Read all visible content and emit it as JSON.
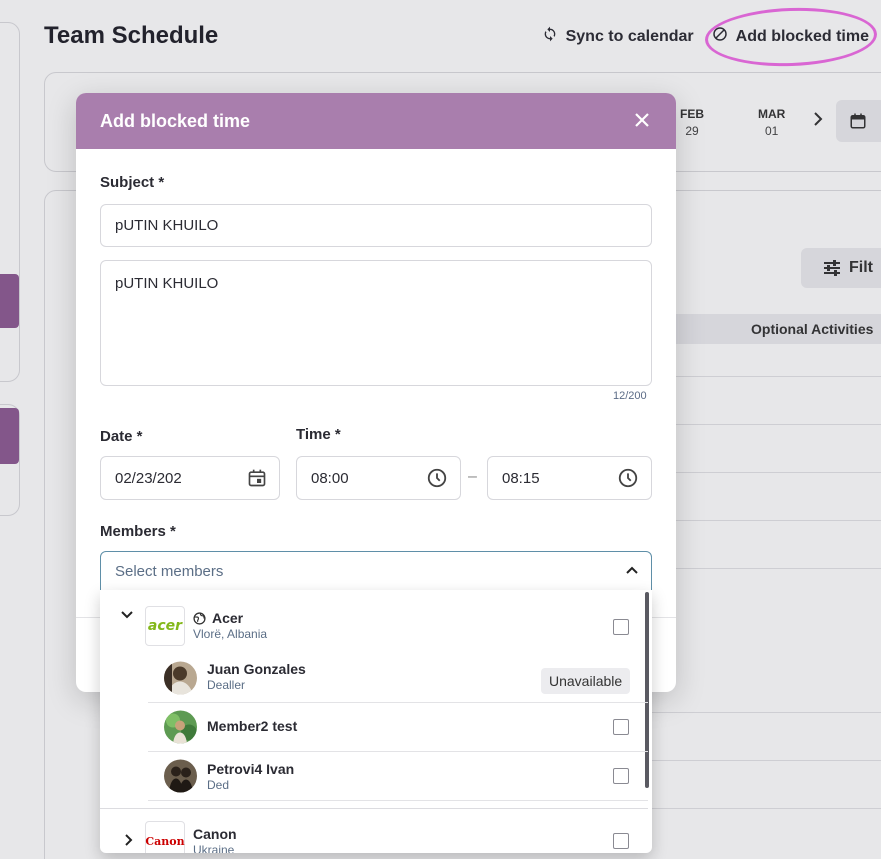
{
  "page": {
    "title": "Team Schedule",
    "sync_label": "Sync to calendar",
    "add_blocked_label": "Add blocked time",
    "dates": [
      {
        "month": "FEB",
        "day": "29"
      },
      {
        "month": "MAR",
        "day": "01"
      }
    ],
    "filter_label": "Filt",
    "column_header": "Optional Activities"
  },
  "modal": {
    "title": "Add blocked time",
    "subject_label": "Subject *",
    "subject_value": "pUTIN KHUILO",
    "description_value": "pUTIN KHUILO",
    "counter": "12/200",
    "date_label": "Date *",
    "date_value": "02/23/202",
    "time_label": "Time *",
    "time_from": "08:00",
    "time_sep": "–",
    "time_to": "08:15",
    "members_label": "Members *",
    "members_placeholder": "Select members"
  },
  "members": {
    "groups": [
      {
        "name": "Acer",
        "location": "Vlorë, Albania",
        "logo_text": "acer",
        "logo_color": "#83b81a"
      },
      {
        "name": "Canon",
        "location": "Ukraine",
        "logo_text": "Canon",
        "logo_color": "#cc0000"
      }
    ],
    "acer_members": [
      {
        "name": "Juan Gonzales",
        "role": "Dealler",
        "badge": "Unavailable"
      },
      {
        "name": "Member2 test",
        "role": ""
      },
      {
        "name": "Petrovi4 Ivan",
        "role": "Ded"
      }
    ]
  },
  "colors": {
    "modal_header": "#a97ead",
    "highlight": "#f06de6",
    "select_border": "#5f8fa8"
  }
}
